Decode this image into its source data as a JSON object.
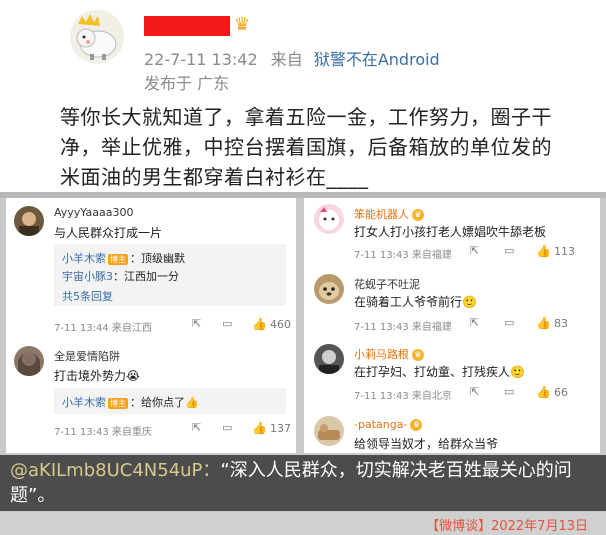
{
  "post": {
    "time": "22-7-11 13:42",
    "source_prefix": "来自",
    "source": "狱警不在Android",
    "location": "发布于 广东",
    "text": "等你长大就知道了，拿着五险一金，工作努力，圈子干净，举止优雅，中控台摆着国旗，后备箱放的单位发的米面油的男生都穿着白衬衫在____"
  },
  "left_comments": [
    {
      "user": "AyyyYaaaa300",
      "text": "与人民群众打成一片",
      "replies": [
        {
          "name": "小羊木索",
          "tag": "博主",
          "text": "：顶级幽默"
        },
        {
          "name": "宇宙小豚3",
          "tag": "",
          "text": "：江西加一分"
        }
      ],
      "more": "共5条回复",
      "foot": "7-11 13:44  来自江西",
      "likes": "460"
    },
    {
      "user": "全是爱情陷阱",
      "text": "打击境外势力😭",
      "replies": [
        {
          "name": "小羊木索",
          "tag": "博主",
          "text": "：给你点了👍"
        }
      ],
      "foot": "7-11 13:43  来自重庆",
      "likes": "137"
    }
  ],
  "right_comments": [
    {
      "user": "笨能机器人",
      "text": "打女人打小孩打老人嫖娼吹牛舔老板",
      "foot": "7-11 13:43  来自福建",
      "likes": "113"
    },
    {
      "user": "花蚬子不吐泥",
      "text": "在骑着工人爷爷前行🙂",
      "foot": "7-11 13:43  来自福建",
      "likes": "83"
    },
    {
      "user": "小莉马路根",
      "text": "在打孕妇、打幼童、打残疾人🙂",
      "foot": "7-11 13:43  来自北京",
      "likes": "66"
    },
    {
      "user": "-patanga-",
      "text": "给领导当奴才，给群众当爷",
      "foot": "",
      "likes": ""
    }
  ],
  "caption": {
    "handle": "@aKILmb8UC4N54uP：",
    "text": "“深入人民群众，切实解决老百姓最关心的问题”。"
  },
  "footer": "【微博谈】2022年7月13日",
  "colors": {
    "accent_red": "#f01818",
    "link_blue": "#3a6ea5",
    "orange_name": "#e8720c",
    "caption_bg": "#4c4c4c"
  }
}
